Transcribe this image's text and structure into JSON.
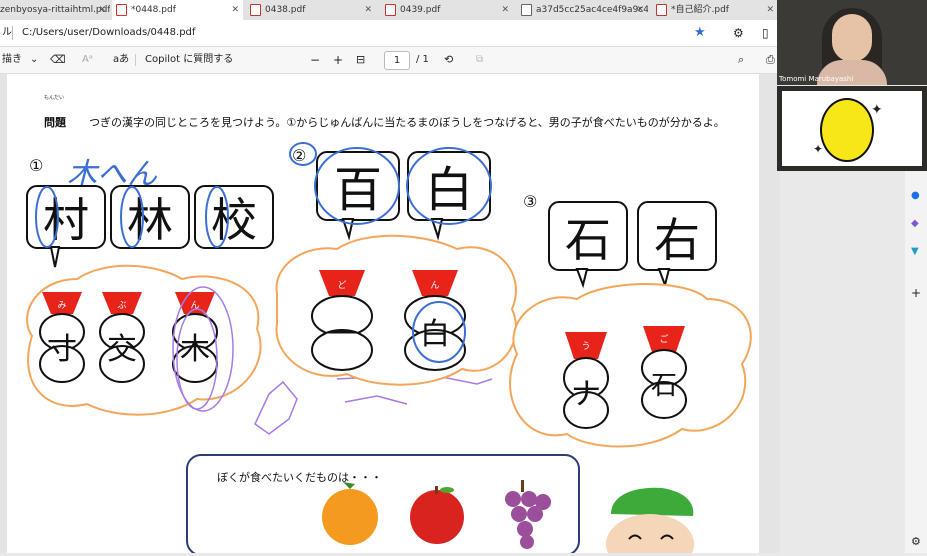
{
  "tabs": [
    {
      "label": "zenbyosya-rittaihtml.pdf"
    },
    {
      "label": "*0448.pdf"
    },
    {
      "label": "0438.pdf"
    },
    {
      "label": "0439.pdf"
    },
    {
      "label": "a37d5cc25ac4ce4f9a9c4"
    },
    {
      "label": "*自己紹介.pdf"
    }
  ],
  "address": {
    "prefix": "ル",
    "url": "C:/Users/user/Downloads/0448.pdf"
  },
  "toolbar": {
    "draw": "描き",
    "read_aloud": "aあ",
    "copilot": "Copilot に質問する",
    "zoom_out": "−",
    "zoom_in": "+",
    "page_current": "1",
    "page_total": "/ 1"
  },
  "video": {
    "participant": "Tomomi Marubayashi"
  },
  "worksheet": {
    "problem_label": "問題",
    "problem_ruby": "もんだい",
    "instruction": "つぎの漢字の同じところを見つけよう。①からじゅんばんに当たるまのぼうしをつなげると、男の子が食べたいものが分かるよ。",
    "handwriting": "木へん",
    "section1": {
      "num": "①",
      "kanji": [
        "村",
        "林",
        "校"
      ],
      "hats": [
        "み",
        "ぶ",
        "ん"
      ],
      "pieces": [
        "寸",
        "交",
        "木"
      ]
    },
    "section2": {
      "num": "②",
      "kanji": [
        "百",
        "白"
      ],
      "hats": [
        "ど",
        "ん"
      ],
      "pieces": [
        "一",
        "白"
      ]
    },
    "section3": {
      "num": "③",
      "kanji": [
        "石",
        "右"
      ],
      "hats": [
        "う",
        "ご"
      ],
      "pieces": [
        "ナ",
        "石"
      ]
    },
    "answer_prompt": "ぼくが食べたいくだものは・・・",
    "fruits": [
      "orange-icon",
      "apple-icon",
      "grapes-icon"
    ]
  },
  "colors": {
    "hat": "#e8231a",
    "cloud": "#f3a65a",
    "ink": "#3b6fd6",
    "purple": "#a77be3"
  }
}
